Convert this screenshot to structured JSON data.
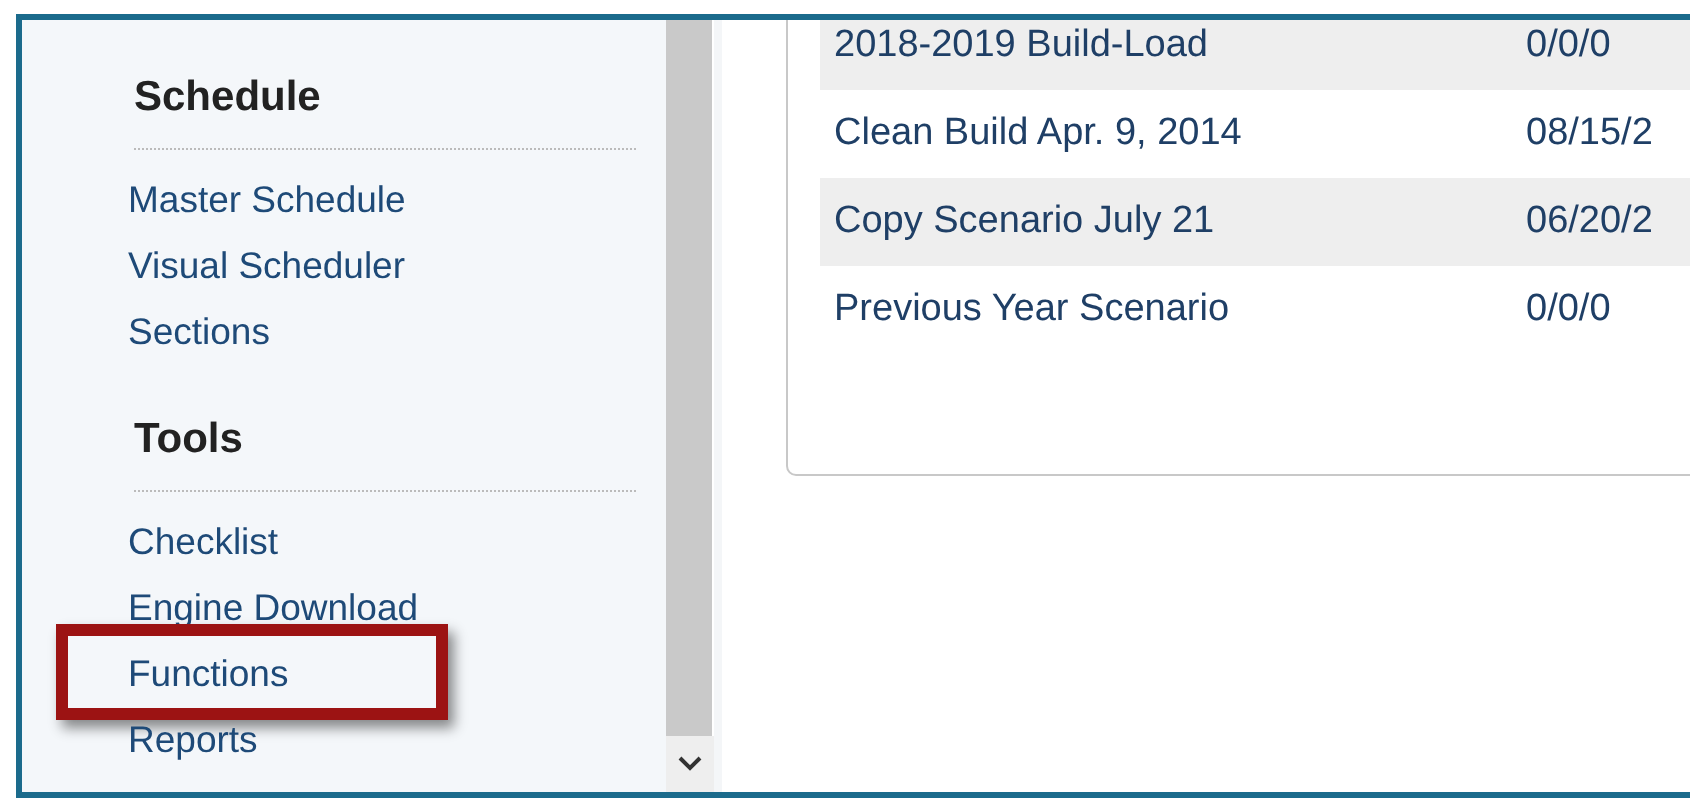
{
  "sidebar": {
    "sections": [
      {
        "heading": "Schedule",
        "items": [
          {
            "label": "Master Schedule",
            "highlighted": false
          },
          {
            "label": "Visual Scheduler",
            "highlighted": false
          },
          {
            "label": "Sections",
            "highlighted": false
          }
        ]
      },
      {
        "heading": "Tools",
        "items": [
          {
            "label": "Checklist",
            "highlighted": false
          },
          {
            "label": "Engine Download",
            "highlighted": false
          },
          {
            "label": "Functions",
            "highlighted": true
          },
          {
            "label": "Reports",
            "highlighted": false
          }
        ]
      }
    ]
  },
  "table": {
    "rows": [
      {
        "scenario": "2018-2019 Build-Load",
        "date": "0/0/0"
      },
      {
        "scenario": "Clean Build Apr. 9, 2014",
        "date": "08/15/2"
      },
      {
        "scenario": "Copy Scenario July 21",
        "date": "06/20/2"
      },
      {
        "scenario": "Previous Year Scenario",
        "date": "0/0/0"
      }
    ]
  }
}
